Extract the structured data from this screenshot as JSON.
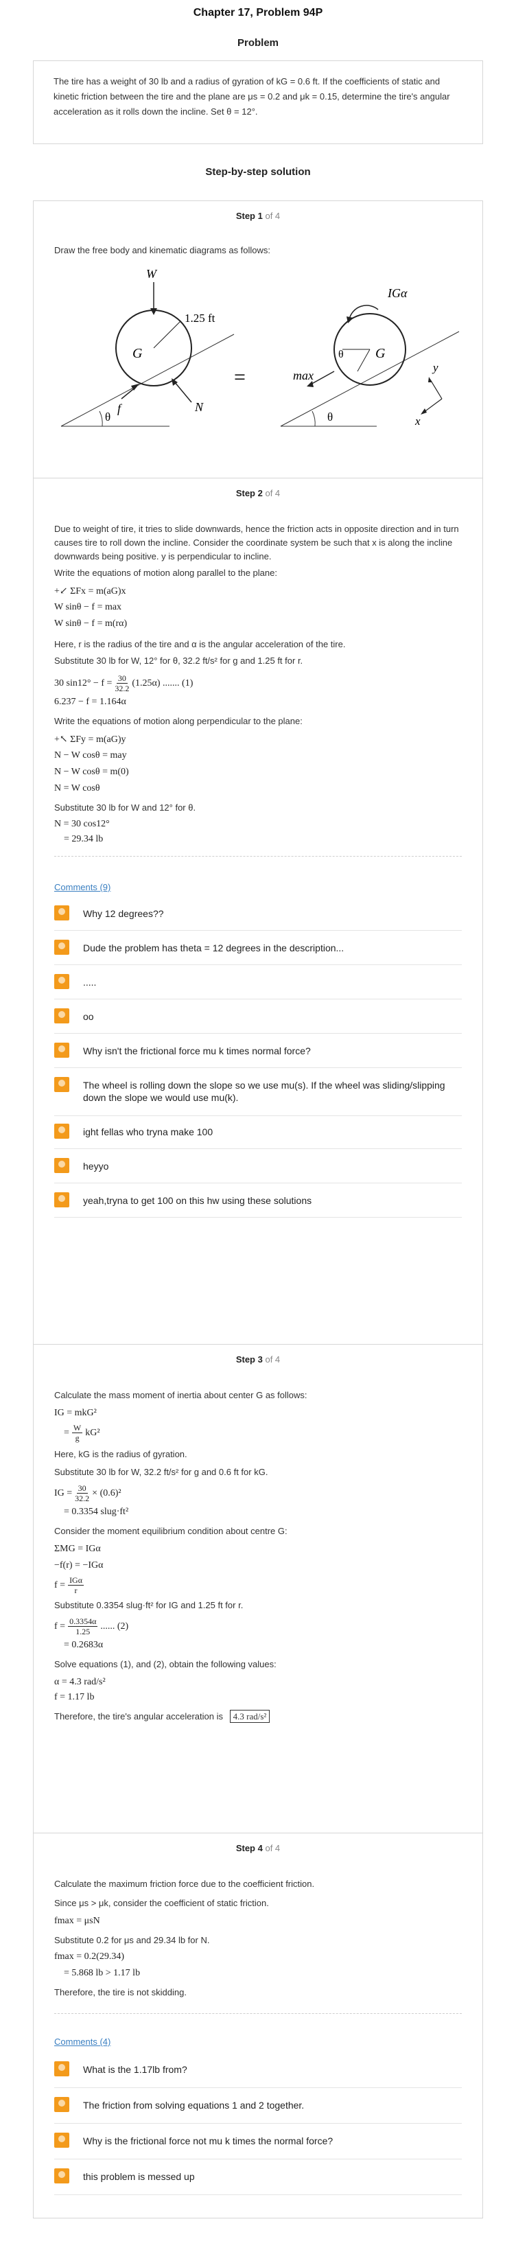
{
  "header": {
    "title": "Chapter 17, Problem 94P"
  },
  "problem": {
    "heading": "Problem",
    "text": "The tire has a weight of 30 lb and a radius of gyration of kG = 0.6 ft. If the coefficients of static and kinetic friction between the tire and the plane are μs = 0.2 and μk = 0.15, determine the tire's angular acceleration as it rolls down the incline. Set θ = 12°."
  },
  "solution": {
    "heading": "Step-by-step solution"
  },
  "steps": [
    {
      "label": "Step 1",
      "of": "of 4",
      "intro": "Draw the free body and kinematic diagrams as follows:",
      "diagram": {
        "W": "W",
        "radius": "1.25 ft",
        "G": "G",
        "f": "f",
        "N": "N",
        "theta": "θ",
        "equals": "=",
        "IGa": "IGα",
        "max": "max",
        "y": "y",
        "x": "x"
      }
    },
    {
      "label": "Step 2",
      "of": "of 4",
      "p1": "Due to weight of tire, it tries to slide downwards, hence the friction acts in opposite direction and in turn causes tire to roll down the incline. Consider the coordinate system be such that x is along the incline downwards being positive. y is perpendicular to incline.",
      "p2": "Write the equations of motion along parallel to the plane:",
      "eq1": "+↙ ΣFx = m(aG)x",
      "eq2": "W sinθ − f = max",
      "eq3": "W sinθ − f = m(rα)",
      "p3": "Here, r is the radius of the tire and α is the angular acceleration of the tire.",
      "p4": "Substitute 30 lb for W, 12° for θ, 32.2 ft/s² for g and 1.25 ft for r.",
      "eq4a": "30 sin12° − f =",
      "eq4frac_num": "30",
      "eq4frac_den": "32.2",
      "eq4b": "(1.25α) ....... (1)",
      "eq5": "6.237 − f = 1.164α",
      "p5": "Write the equations of motion along perpendicular to the plane:",
      "eq6": "+↖ ΣFy = m(aG)y",
      "eq7": "N − W cosθ = may",
      "eq8": "N − W cosθ = m(0)",
      "eq9": "N = W cosθ",
      "p6": "Substitute 30 lb for W and 12° for θ.",
      "eq10": "N = 30 cos12°",
      "eq11": "= 29.34 lb",
      "comments_label": "Comments (9)",
      "comments": [
        "Why 12 degrees??",
        "Dude the problem has theta = 12 degrees in the description...",
        ".....",
        "oo",
        "Why isn't the frictional force mu k times normal force?",
        "The wheel is rolling down the slope so we use mu(s). If the wheel was sliding/slipping down the slope we would use mu(k).",
        "ight fellas who tryna make 100",
        "heyyo",
        "yeah,tryna to get 100 on this hw using these solutions"
      ]
    },
    {
      "label": "Step 3",
      "of": "of 4",
      "p1": "Calculate the mass moment of inertia about center G as follows:",
      "eq1": "IG = mkG²",
      "eq2a": "=",
      "eq2num": "W",
      "eq2den": "g",
      "eq2b": "kG²",
      "p2": "Here, kG is the radius of gyration.",
      "p3": "Substitute 30 lb for W, 32.2 ft/s² for g and 0.6 ft for kG.",
      "eq3a": "IG =",
      "eq3num": "30",
      "eq3den": "32.2",
      "eq3b": "× (0.6)²",
      "eq4": "= 0.3354 slug·ft²",
      "p4": "Consider the moment equilibrium condition about centre G:",
      "eq5": "ΣMG = IGα",
      "eq6": "−f(r) = −IGα",
      "eq7a": "f =",
      "eq7num": "IGα",
      "eq7den": "r",
      "p5": "Substitute 0.3354 slug·ft² for IG and 1.25 ft for r.",
      "eq8a": "f =",
      "eq8num": "0.3354α",
      "eq8den": "1.25",
      "eq8b": "...... (2)",
      "eq9": "= 0.2683α",
      "p6": "Solve equations (1), and (2), obtain the following values:",
      "eq10": "α = 4.3 rad/s²",
      "eq11": "f = 1.17 lb",
      "p7": "Therefore, the tire's angular acceleration is",
      "answer": "4.3 rad/s²"
    },
    {
      "label": "Step 4",
      "of": "of 4",
      "p1": "Calculate the maximum friction force due to the coefficient friction.",
      "p2": "Since μs > μk, consider the coefficient of static friction.",
      "eq1": "fmax = μsN",
      "p3": "Substitute 0.2 for μs and 29.34 lb for N.",
      "eq2": "fmax = 0.2(29.34)",
      "eq3": "= 5.868 lb > 1.17 lb",
      "p4": "Therefore, the tire is not skidding.",
      "comments_label": "Comments (4)",
      "comments": [
        "What is the 1.17lb from?",
        "The friction from solving equations 1 and 2 together.",
        "Why is the frictional force not mu k times the normal force?",
        "this problem is messed up"
      ]
    }
  ],
  "colors": {
    "link": "#3a7fc1",
    "avatar": "#f39a1b",
    "border": "#d6d6d6"
  }
}
